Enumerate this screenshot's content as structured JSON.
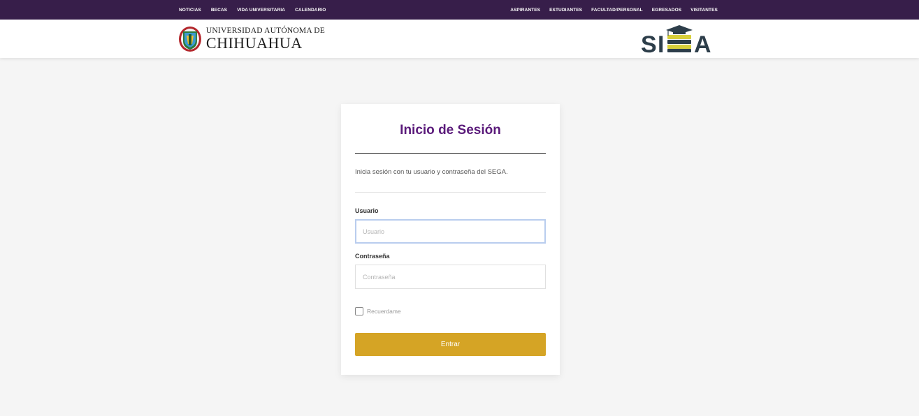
{
  "topnav": {
    "left": [
      "NOTICIAS",
      "BECAS",
      "VIDA UNIVERSITARIA",
      "CALENDARIO"
    ],
    "right": [
      "ASPIRANTES",
      "ESTUDIANTES",
      "FACULTAD/PERSONAL",
      "EGRESADOS",
      "VISITANTES"
    ]
  },
  "header": {
    "university_line1": "UNIVERSIDAD AUTÓNOMA DE",
    "university_line2": "CHIHUAHUA",
    "siga_logo": "SIGA"
  },
  "login": {
    "title": "Inicio de Sesión",
    "subtitle": "Inicia sesión con tu usuario y contraseña del SEGA.",
    "username_label": "Usuario",
    "username_placeholder": "Usuario",
    "username_value": "",
    "password_label": "Contraseña",
    "password_placeholder": "Contraseña",
    "password_value": "",
    "remember_label": "Recuerdame",
    "remember_checked": false,
    "submit_label": "Entrar"
  },
  "colors": {
    "topnav_bg": "#371e4a",
    "title": "#5a1a7a",
    "button": "#d5a425",
    "siga_dark": "#2d3e4a",
    "siga_yellow": "#d7cf3b"
  }
}
